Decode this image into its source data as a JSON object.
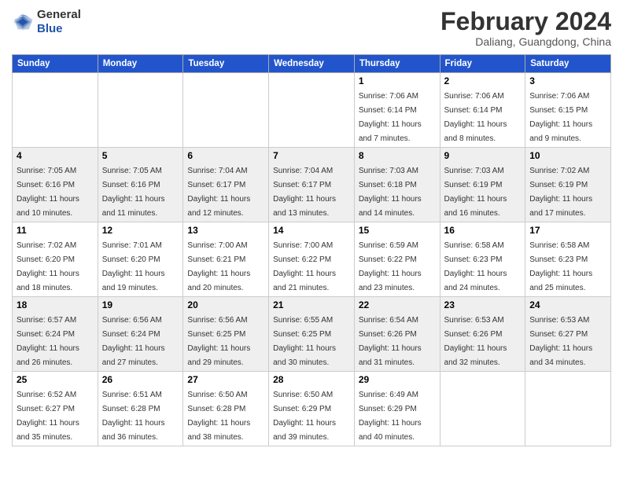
{
  "header": {
    "logo_line1": "General",
    "logo_line2": "Blue",
    "month": "February 2024",
    "location": "Daliang, Guangdong, China"
  },
  "weekdays": [
    "Sunday",
    "Monday",
    "Tuesday",
    "Wednesday",
    "Thursday",
    "Friday",
    "Saturday"
  ],
  "rows": [
    [
      {
        "day": "",
        "info": ""
      },
      {
        "day": "",
        "info": ""
      },
      {
        "day": "",
        "info": ""
      },
      {
        "day": "",
        "info": ""
      },
      {
        "day": "1",
        "info": "Sunrise: 7:06 AM\nSunset: 6:14 PM\nDaylight: 11 hours\nand 7 minutes."
      },
      {
        "day": "2",
        "info": "Sunrise: 7:06 AM\nSunset: 6:14 PM\nDaylight: 11 hours\nand 8 minutes."
      },
      {
        "day": "3",
        "info": "Sunrise: 7:06 AM\nSunset: 6:15 PM\nDaylight: 11 hours\nand 9 minutes."
      }
    ],
    [
      {
        "day": "4",
        "info": "Sunrise: 7:05 AM\nSunset: 6:16 PM\nDaylight: 11 hours\nand 10 minutes."
      },
      {
        "day": "5",
        "info": "Sunrise: 7:05 AM\nSunset: 6:16 PM\nDaylight: 11 hours\nand 11 minutes."
      },
      {
        "day": "6",
        "info": "Sunrise: 7:04 AM\nSunset: 6:17 PM\nDaylight: 11 hours\nand 12 minutes."
      },
      {
        "day": "7",
        "info": "Sunrise: 7:04 AM\nSunset: 6:17 PM\nDaylight: 11 hours\nand 13 minutes."
      },
      {
        "day": "8",
        "info": "Sunrise: 7:03 AM\nSunset: 6:18 PM\nDaylight: 11 hours\nand 14 minutes."
      },
      {
        "day": "9",
        "info": "Sunrise: 7:03 AM\nSunset: 6:19 PM\nDaylight: 11 hours\nand 16 minutes."
      },
      {
        "day": "10",
        "info": "Sunrise: 7:02 AM\nSunset: 6:19 PM\nDaylight: 11 hours\nand 17 minutes."
      }
    ],
    [
      {
        "day": "11",
        "info": "Sunrise: 7:02 AM\nSunset: 6:20 PM\nDaylight: 11 hours\nand 18 minutes."
      },
      {
        "day": "12",
        "info": "Sunrise: 7:01 AM\nSunset: 6:20 PM\nDaylight: 11 hours\nand 19 minutes."
      },
      {
        "day": "13",
        "info": "Sunrise: 7:00 AM\nSunset: 6:21 PM\nDaylight: 11 hours\nand 20 minutes."
      },
      {
        "day": "14",
        "info": "Sunrise: 7:00 AM\nSunset: 6:22 PM\nDaylight: 11 hours\nand 21 minutes."
      },
      {
        "day": "15",
        "info": "Sunrise: 6:59 AM\nSunset: 6:22 PM\nDaylight: 11 hours\nand 23 minutes."
      },
      {
        "day": "16",
        "info": "Sunrise: 6:58 AM\nSunset: 6:23 PM\nDaylight: 11 hours\nand 24 minutes."
      },
      {
        "day": "17",
        "info": "Sunrise: 6:58 AM\nSunset: 6:23 PM\nDaylight: 11 hours\nand 25 minutes."
      }
    ],
    [
      {
        "day": "18",
        "info": "Sunrise: 6:57 AM\nSunset: 6:24 PM\nDaylight: 11 hours\nand 26 minutes."
      },
      {
        "day": "19",
        "info": "Sunrise: 6:56 AM\nSunset: 6:24 PM\nDaylight: 11 hours\nand 27 minutes."
      },
      {
        "day": "20",
        "info": "Sunrise: 6:56 AM\nSunset: 6:25 PM\nDaylight: 11 hours\nand 29 minutes."
      },
      {
        "day": "21",
        "info": "Sunrise: 6:55 AM\nSunset: 6:25 PM\nDaylight: 11 hours\nand 30 minutes."
      },
      {
        "day": "22",
        "info": "Sunrise: 6:54 AM\nSunset: 6:26 PM\nDaylight: 11 hours\nand 31 minutes."
      },
      {
        "day": "23",
        "info": "Sunrise: 6:53 AM\nSunset: 6:26 PM\nDaylight: 11 hours\nand 32 minutes."
      },
      {
        "day": "24",
        "info": "Sunrise: 6:53 AM\nSunset: 6:27 PM\nDaylight: 11 hours\nand 34 minutes."
      }
    ],
    [
      {
        "day": "25",
        "info": "Sunrise: 6:52 AM\nSunset: 6:27 PM\nDaylight: 11 hours\nand 35 minutes."
      },
      {
        "day": "26",
        "info": "Sunrise: 6:51 AM\nSunset: 6:28 PM\nDaylight: 11 hours\nand 36 minutes."
      },
      {
        "day": "27",
        "info": "Sunrise: 6:50 AM\nSunset: 6:28 PM\nDaylight: 11 hours\nand 38 minutes."
      },
      {
        "day": "28",
        "info": "Sunrise: 6:50 AM\nSunset: 6:29 PM\nDaylight: 11 hours\nand 39 minutes."
      },
      {
        "day": "29",
        "info": "Sunrise: 6:49 AM\nSunset: 6:29 PM\nDaylight: 11 hours\nand 40 minutes."
      },
      {
        "day": "",
        "info": ""
      },
      {
        "day": "",
        "info": ""
      }
    ]
  ]
}
